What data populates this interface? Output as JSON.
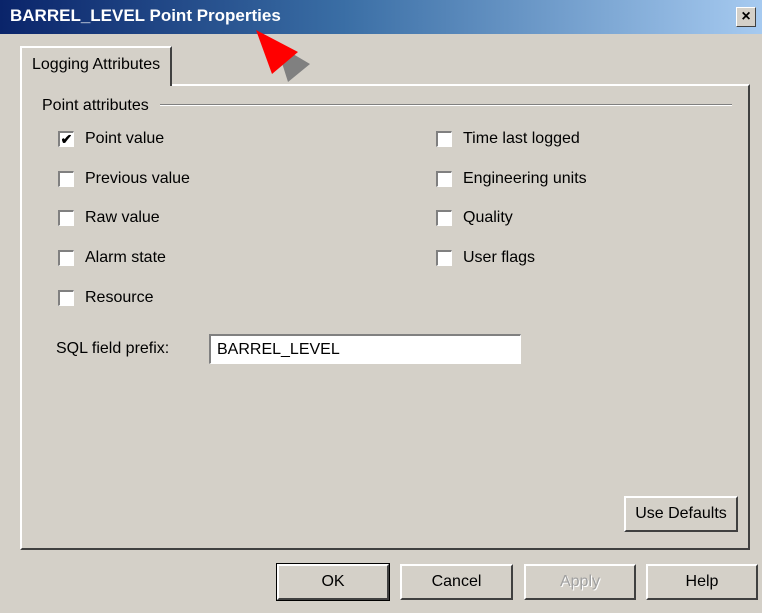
{
  "window": {
    "title": "BARREL_LEVEL Point Properties",
    "close_glyph": "×"
  },
  "tabs": [
    {
      "label": "Logging Attributes",
      "selected": true
    }
  ],
  "group": {
    "label": "Point attributes"
  },
  "checkboxes_left": [
    {
      "label": "Point value",
      "checked": true
    },
    {
      "label": "Previous value",
      "checked": false
    },
    {
      "label": "Raw value",
      "checked": false
    },
    {
      "label": "Alarm state",
      "checked": false
    },
    {
      "label": "Resource",
      "checked": false
    }
  ],
  "checkboxes_right": [
    {
      "label": "Time last logged",
      "checked": false
    },
    {
      "label": "Engineering units",
      "checked": false
    },
    {
      "label": "Quality",
      "checked": false
    },
    {
      "label": "User flags",
      "checked": false
    }
  ],
  "sql_prefix": {
    "label": "SQL field prefix:",
    "value": "BARREL_LEVEL"
  },
  "buttons": {
    "use_defaults": "Use Defaults",
    "ok": "OK",
    "cancel": "Cancel",
    "apply": "Apply",
    "help": "Help"
  },
  "check_glyph": "✔",
  "colors": {
    "titlebar_start": "#0a246a",
    "titlebar_end": "#a6caf0",
    "face": "#d4d0c8",
    "annotation_arrow": "#ff0000"
  }
}
